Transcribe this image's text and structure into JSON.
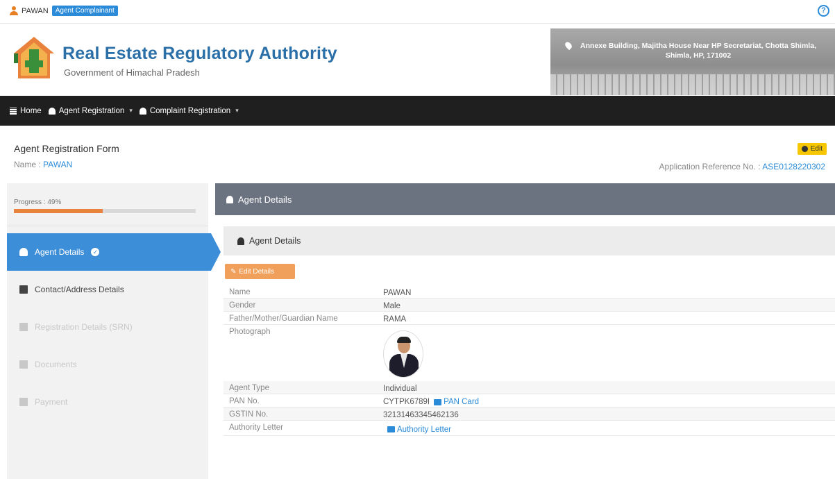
{
  "topbar": {
    "username": "PAWAN",
    "role_badge": "Agent Complainant"
  },
  "header": {
    "title": "Real Estate Regulatory Authority",
    "subtitle": "Government of Himachal Pradesh",
    "address": "Annexe Building, Majitha House Near HP Secretariat, Chotta Shimla, Shimla, HP, 171002"
  },
  "nav": {
    "home": "Home",
    "agent_registration": "Agent Registration",
    "complaint_registration": "Complaint Registration"
  },
  "form": {
    "title": "Agent Registration Form",
    "name_label": "Name :",
    "name_value": "PAWAN",
    "edit_chip": "Edit",
    "app_ref_label": "Application Reference No. :",
    "app_ref_value": "ASE0128220302"
  },
  "sidebar": {
    "progress_label": "Progress : 49%",
    "progress": 0.49,
    "items": [
      {
        "label": "Agent Details"
      },
      {
        "label": "Contact/Address Details"
      },
      {
        "label": "Registration Details (SRN)"
      },
      {
        "label": "Documents"
      },
      {
        "label": "Payment"
      }
    ]
  },
  "main": {
    "panel_title": "Agent Details",
    "section_title": "Agent Details",
    "edit_button": "Edit Details",
    "fields": [
      {
        "key": "Name",
        "value": "PAWAN"
      },
      {
        "key": "Gender",
        "value": "Male"
      },
      {
        "key": "Father/Mother/Guardian Name",
        "value": "RAMA"
      },
      {
        "key": "Photograph",
        "value": ""
      },
      {
        "key": "Agent Type",
        "value": "Individual"
      },
      {
        "key": "PAN No.",
        "value": "CYTPK6789I",
        "link": "PAN Card"
      },
      {
        "key": "GSTIN No.",
        "value": "32131463345462136"
      },
      {
        "key": "Authority Letter",
        "value": "",
        "link": "Authority Letter"
      }
    ]
  },
  "colors": {
    "brand_blue": "#2a6fa8",
    "accent_blue": "#3d8ed8",
    "nav_dark": "#1f1f1f",
    "orange": "#e8823c"
  }
}
